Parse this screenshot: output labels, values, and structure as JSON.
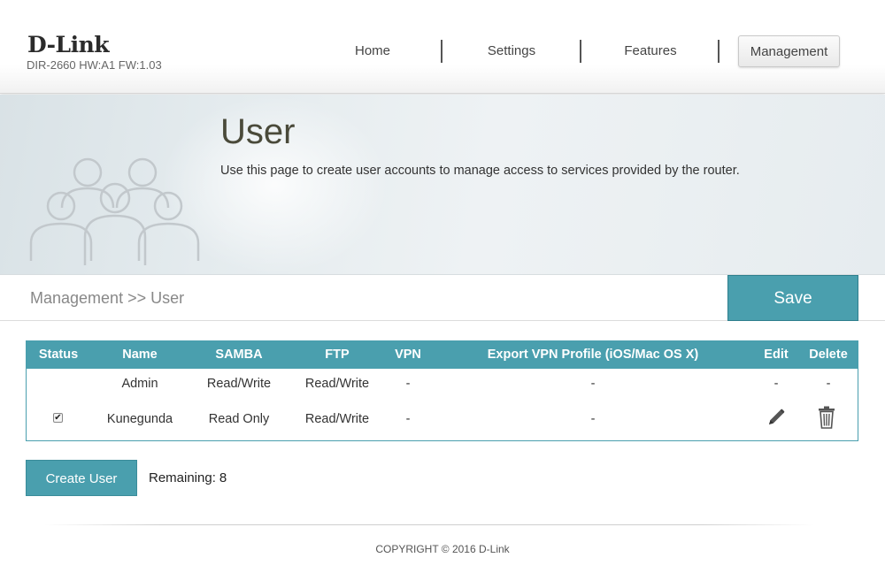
{
  "header": {
    "logo": "D-Link",
    "hw_info": "DIR-2660 HW:A1 FW:1.03",
    "nav": [
      {
        "label": "Home"
      },
      {
        "label": "Settings"
      },
      {
        "label": "Features"
      },
      {
        "label": "Management",
        "active": true
      }
    ]
  },
  "banner": {
    "title": "User",
    "description": "Use this page to create user accounts to manage access to services provided by the router.",
    "icon": "users-group-icon"
  },
  "breadcrumb": "Management >> User",
  "save_label": "Save",
  "table": {
    "columns": [
      "Status",
      "Name",
      "SAMBA",
      "FTP",
      "VPN",
      "Export VPN Profile (iOS/Mac OS X)",
      "Edit",
      "Delete"
    ],
    "rows": [
      {
        "status": "",
        "status_checked": null,
        "name": "Admin",
        "samba": "Read/Write",
        "ftp": "Read/Write",
        "vpn": "-",
        "export": "-",
        "edit": "-",
        "delete": "-"
      },
      {
        "status": "",
        "status_checked": true,
        "name": "Kunegunda",
        "samba": "Read Only",
        "ftp": "Read/Write",
        "vpn": "-",
        "export": "-",
        "edit": "pencil-icon",
        "delete": "trash-icon"
      }
    ]
  },
  "create_user_label": "Create User",
  "remaining_label": "Remaining:",
  "remaining_count": "8",
  "copyright": "COPYRIGHT © 2016 D-Link",
  "colors": {
    "accent": "#4a9fae"
  }
}
